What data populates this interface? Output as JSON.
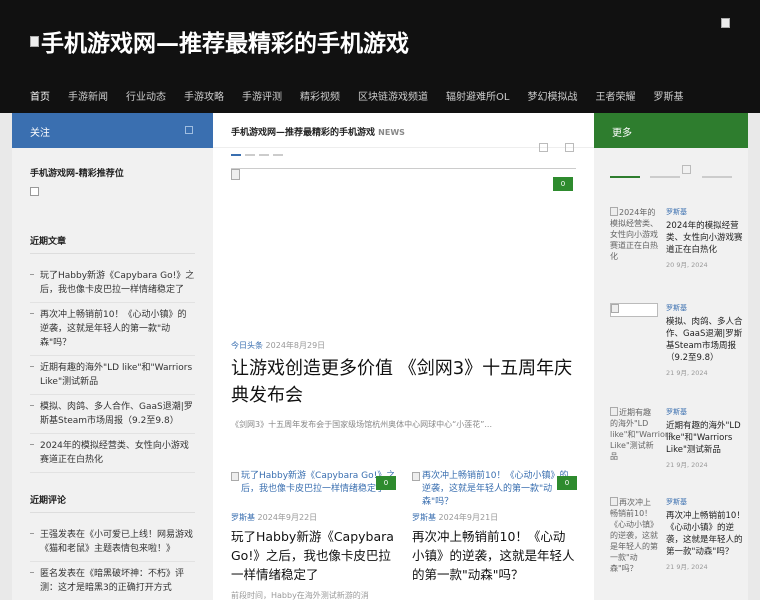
{
  "header": {
    "site_title": "手机游戏网—推荐最精彩的手机游戏",
    "nav": [
      "首页",
      "手游新闻",
      "行业动态",
      "手游攻略",
      "手游评测",
      "精彩视频",
      "区块链游戏频道",
      "辐射避难所OL",
      "梦幻模拟战",
      "王者荣耀",
      "罗斯基"
    ]
  },
  "left": {
    "head": "关注",
    "recommend_title": "手机游戏网-精彩推荐位",
    "recent_posts_title": "近期文章",
    "recent_posts": [
      "玩了Habby新游《Capybara Go!》之后，我也像卡皮巴拉一样情绪稳定了",
      "再次冲上畅销前10！《心动小镇》的逆袭，这就是年轻人的第一款\"动森\"吗？",
      "近期有趣的海外\"LD like\"和\"Warriors Like\"测试新品",
      "模拟、肉鸽、多人合作、GaaS退潮|罗斯基Steam市场周报（9.2至9.8）",
      "2024年的模拟经营类、女性向小游戏赛道正在白热化"
    ],
    "recent_comments_title": "近期评论",
    "recent_comments": [
      "王强发表在《小可爱已上线！网易游戏《猫和老鼠》主题表情包来啦！》",
      "匿名发表在《暗黑破坏神：不朽》评测：这才是暗黑3的正确打开方式"
    ]
  },
  "center": {
    "head_title": "手机游戏网—推荐最精彩的手机游戏",
    "head_tag": "NEWS",
    "featured": {
      "category": "今日头条",
      "date": "2024年8月29日",
      "title": "让游戏创造更多价值 《剑网3》十五周年庆典发布会",
      "excerpt": "《剑网3》十五周年发布会于国家级场馆杭州奥体中心网球中心“小莲花”..."
    },
    "cards": [
      {
        "thumb_alt": "玩了Habby新游《Capybara Go!》之后，我也像卡皮巴拉一样情绪稳定了",
        "category": "罗斯基",
        "date": "2024年9月22日",
        "title": "玩了Habby新游《Capybara Go!》之后，我也像卡皮巴拉一样情绪稳定了",
        "excerpt": "前段时间，Habby在海外测试新游的消"
      },
      {
        "thumb_alt": "再次冲上畅销前10！《心动小镇》的逆袭，这就是年轻人的第一款\"动森\"吗？",
        "category": "罗斯基",
        "date": "2024年9月21日",
        "title": "再次冲上畅销前10！《心动小镇》的逆袭，这就是年轻人的第一款\"动森\"吗？",
        "excerpt": ""
      }
    ],
    "badge": "0"
  },
  "right": {
    "head": "更多",
    "items": [
      {
        "thumb_alt": "2024年的模拟经营类、女性向小游戏赛道正在白热化",
        "category": "罗斯基",
        "title": "2024年的模拟经营类、女性向小游戏赛道正在白热化",
        "date": "20 9月, 2024"
      },
      {
        "thumb_alt": "",
        "category": "罗斯基",
        "title": "模拟、肉鸽、多人合作、GaaS退潮|罗斯基Steam市场周报（9.2至9.8）",
        "date": "21 9月, 2024"
      },
      {
        "thumb_alt": "近期有趣的海外\"LD like\"和\"Warriors Like\"测试新品",
        "category": "罗斯基",
        "title": "近期有趣的海外\"LD like\"和\"Warriors Like\"测试新品",
        "date": "21 9月, 2024"
      },
      {
        "thumb_alt": "再次冲上畅销前10！《心动小镇》的逆袭，这就是年轻人的第一款\"动森\"吗？",
        "category": "罗斯基",
        "title": "再次冲上畅销前10！《心动小镇》的逆袭，这就是年轻人的第一款\"动森\"吗？",
        "date": "21 9月, 2024"
      }
    ]
  },
  "colors": {
    "header_bg": "#111111",
    "left_head": "#3a6fb0",
    "right_head": "#2e7d2e",
    "accent": "#3a6fb0"
  }
}
